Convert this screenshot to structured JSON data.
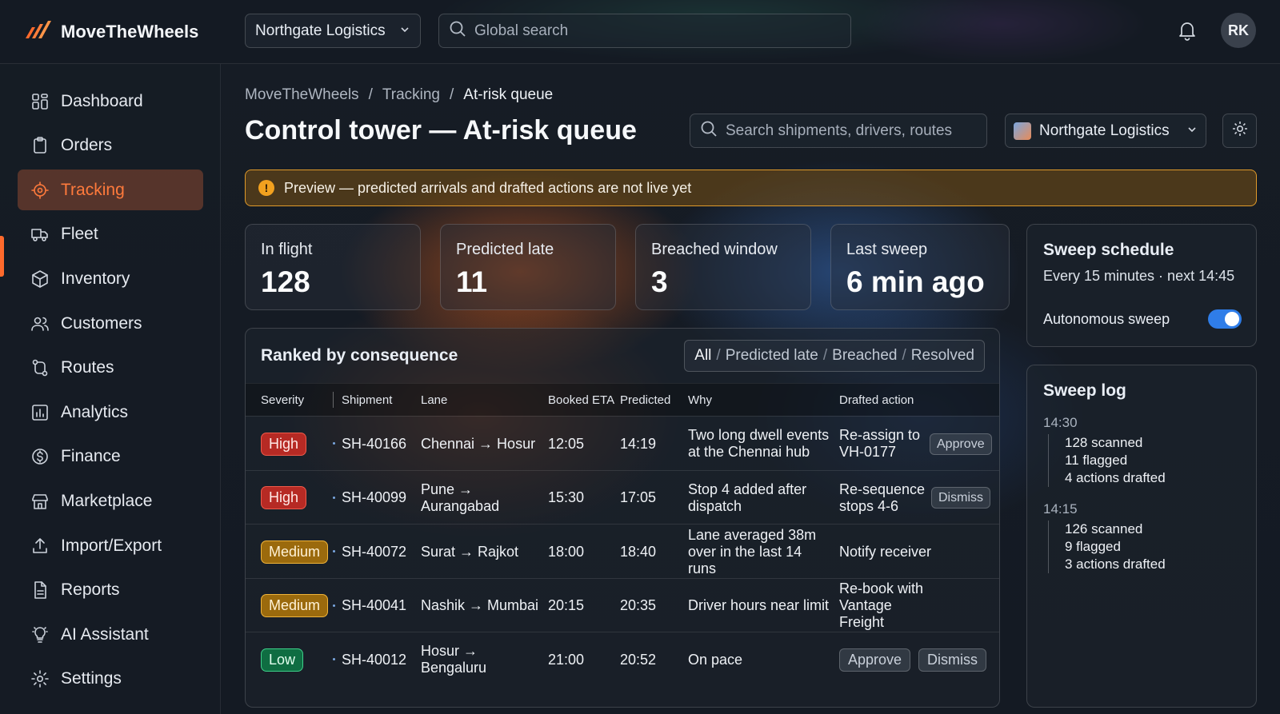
{
  "app": {
    "name": "MoveTheWheels",
    "avatar_initials": "RK"
  },
  "topbar": {
    "org": "Northgate Logistics",
    "search_placeholder": "Global search"
  },
  "sidebar": {
    "items": [
      {
        "label": "Dashboard",
        "icon": "dashboard-icon"
      },
      {
        "label": "Orders",
        "icon": "clipboard-icon"
      },
      {
        "label": "Tracking",
        "icon": "target-icon",
        "active": true
      },
      {
        "label": "Fleet",
        "icon": "truck-icon"
      },
      {
        "label": "Inventory",
        "icon": "box-icon"
      },
      {
        "label": "Customers",
        "icon": "users-icon"
      },
      {
        "label": "Routes",
        "icon": "route-icon"
      },
      {
        "label": "Analytics",
        "icon": "chart-icon"
      },
      {
        "label": "Finance",
        "icon": "dollar-icon"
      },
      {
        "label": "Marketplace",
        "icon": "store-icon"
      },
      {
        "label": "Import/Export",
        "icon": "upload-icon"
      },
      {
        "label": "Reports",
        "icon": "document-icon"
      },
      {
        "label": "AI Assistant",
        "icon": "bulb-icon"
      },
      {
        "label": "Settings",
        "icon": "gear-icon"
      }
    ]
  },
  "breadcrumb": [
    "MoveTheWheels",
    "Tracking",
    "At-risk queue"
  ],
  "page": {
    "title": "Control tower — At-risk queue",
    "search_placeholder": "Search shipments, drivers, routes",
    "org": "Northgate Logistics"
  },
  "banner": "Preview — predicted arrivals and drafted actions are not live yet",
  "stats": [
    {
      "label": "In flight",
      "value": "128"
    },
    {
      "label": "Predicted late",
      "value": "11"
    },
    {
      "label": "Breached window",
      "value": "3"
    },
    {
      "label": "Last sweep",
      "value": "6 min ago"
    }
  ],
  "queue": {
    "title": "Ranked by consequence",
    "filters": [
      "All",
      "Predicted late",
      "Breached",
      "Resolved"
    ],
    "columns": [
      "Severity",
      "Shipment",
      "Lane",
      "Booked ETA",
      "Predicted",
      "Why",
      "Drafted action"
    ],
    "rows": [
      {
        "severity": "High",
        "shipment": "SH-40166",
        "lane": "Chennai → Hosur",
        "booked": "12:05",
        "predicted": "14:19",
        "why": "Two long dwell events at the Chennai hub",
        "action": "Re-assign to VH-0177",
        "buttons": [
          "Approve"
        ]
      },
      {
        "severity": "High",
        "shipment": "SH-40099",
        "lane": "Pune → Aurangabad",
        "booked": "15:30",
        "predicted": "17:05",
        "why": "Stop 4 added after dispatch",
        "action": "Re-sequence stops 4-6",
        "buttons": [
          "Dismiss"
        ]
      },
      {
        "severity": "Medium",
        "shipment": "SH-40072",
        "lane": "Surat → Rajkot",
        "booked": "18:00",
        "predicted": "18:40",
        "why": "Lane averaged 38m over in the last 14 runs",
        "action": "Notify receiver",
        "buttons": []
      },
      {
        "severity": "Medium",
        "shipment": "SH-40041",
        "lane": "Nashik → Mumbai",
        "booked": "20:15",
        "predicted": "20:35",
        "why": "Driver hours near limit",
        "action": "Re-book with Vantage Freight",
        "buttons": []
      },
      {
        "severity": "Low",
        "shipment": "SH-40012",
        "lane": "Hosur → Bengaluru",
        "booked": "21:00",
        "predicted": "20:52",
        "why": "On pace",
        "action": "",
        "buttons": [
          "Approve",
          "Dismiss"
        ]
      }
    ]
  },
  "schedule": {
    "title": "Sweep schedule",
    "subtitle": "Every 15 minutes · next 14:45",
    "toggle_label": "Autonomous sweep",
    "toggle_on": true
  },
  "sweep_log": {
    "title": "Sweep log",
    "entries": [
      {
        "time": "14:30",
        "lines": [
          "128 scanned",
          "11 flagged",
          "4 actions drafted"
        ]
      },
      {
        "time": "14:15",
        "lines": [
          "126 scanned",
          "9 flagged",
          "3 actions drafted"
        ]
      }
    ]
  },
  "colors": {
    "accent": "#ff6a2c",
    "high": "#b62a24",
    "medium": "#9b6a0d",
    "low": "#0f6d42",
    "toggle": "#2f7de8"
  }
}
